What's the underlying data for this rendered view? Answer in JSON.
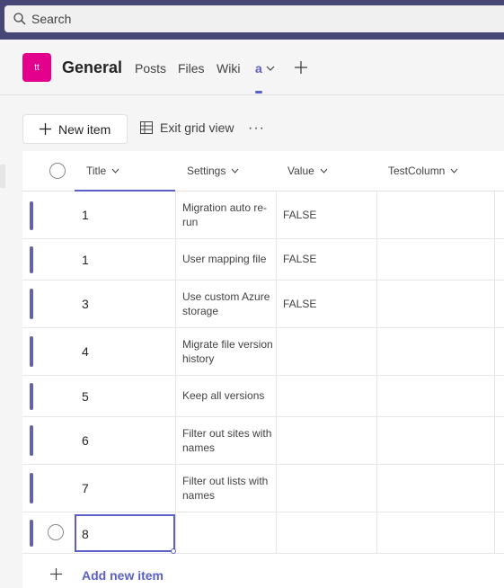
{
  "search": {
    "placeholder": "Search"
  },
  "channel": {
    "avatar_initials": "tt",
    "avatar_color": "#e3008c",
    "title": "General",
    "tabs": [
      "Posts",
      "Files",
      "Wiki",
      "a"
    ],
    "active_tab": "a"
  },
  "toolbar": {
    "new_item_label": "New item",
    "exit_grid_label": "Exit grid view",
    "more_label": "···"
  },
  "grid": {
    "columns": [
      "Title",
      "Settings",
      "Value",
      "TestColumn"
    ],
    "rows": [
      {
        "title": "1",
        "settings": "Migration auto re-run",
        "value": "FALSE"
      },
      {
        "title": "1",
        "settings": "User mapping file",
        "value": "FALSE"
      },
      {
        "title": "3",
        "settings": "Use custom Azure storage",
        "value": "FALSE"
      },
      {
        "title": "4",
        "settings": "Migrate file version history",
        "value": ""
      },
      {
        "title": "5",
        "settings": "Keep all versions",
        "value": ""
      },
      {
        "title": "6",
        "settings": "Filter out sites with names",
        "value": ""
      },
      {
        "title": "7",
        "settings": "Filter out lists with names",
        "value": ""
      }
    ],
    "editing_row": {
      "title": "8"
    },
    "add_new_label": "Add new item"
  },
  "colors": {
    "accent": "#5b5fc7",
    "row_bar": "#6264a7",
    "topbar": "#464775"
  }
}
